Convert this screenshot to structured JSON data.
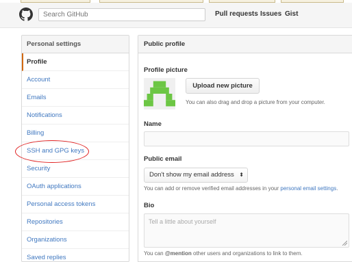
{
  "header": {
    "search_placeholder": "Search GitHub",
    "nav": [
      "Pull requests",
      "Issues",
      "Gist"
    ]
  },
  "sidebar": {
    "heading": "Personal settings",
    "items": [
      {
        "label": "Profile",
        "selected": true
      },
      {
        "label": "Account"
      },
      {
        "label": "Emails"
      },
      {
        "label": "Notifications"
      },
      {
        "label": "Billing"
      },
      {
        "label": "SSH and GPG keys"
      },
      {
        "label": "Security"
      },
      {
        "label": "OAuth applications"
      },
      {
        "label": "Personal access tokens"
      },
      {
        "label": "Repositories"
      },
      {
        "label": "Organizations"
      },
      {
        "label": "Saved replies"
      }
    ]
  },
  "profile": {
    "heading": "Public profile",
    "picture_label": "Profile picture",
    "upload_button": "Upload new picture",
    "upload_hint": "You can also drag and drop a picture from your computer.",
    "name_label": "Name",
    "name_value": "",
    "email_label": "Public email",
    "email_selected": "Don't show my email address",
    "email_hint_prefix": "You can add or remove verified email addresses in your ",
    "email_hint_link": "personal email settings",
    "email_hint_suffix": ".",
    "bio_label": "Bio",
    "bio_placeholder": "Tell a little about yourself",
    "bio_hint_prefix": "You can ",
    "bio_hint_mention": "@mention",
    "bio_hint_suffix": " other users and organizations to link to them."
  },
  "colors": {
    "accent": "#d26911",
    "link": "#4078c0",
    "avatar": "#6cc644",
    "annotation": "#e02020"
  }
}
